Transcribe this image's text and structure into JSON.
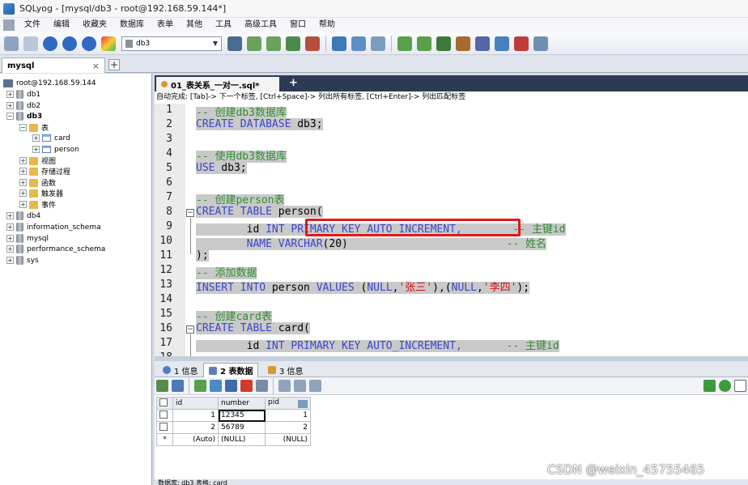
{
  "window": {
    "title": "SQLyog - [mysql/db3 - root@192.168.59.144*]"
  },
  "menu": [
    "文件",
    "编辑",
    "收藏夹",
    "数据库",
    "表单",
    "其他",
    "工具",
    "高级工具",
    "窗口",
    "帮助"
  ],
  "toolbar": {
    "selected_db": "db3"
  },
  "connection_tab": {
    "label": "mysql",
    "close": "×",
    "add": "+"
  },
  "tree": {
    "server": "root@192.168.59.144",
    "db1": "db1",
    "db2": "db2",
    "db3": "db3",
    "tables_folder": "表",
    "table_card": "card",
    "table_person": "person",
    "views": "视图",
    "procedures": "存储过程",
    "functions": "函数",
    "triggers": "触发器",
    "events": "事件",
    "db4": "db4",
    "information_schema": "information_schema",
    "mysql": "mysql",
    "performance_schema": "performance_schema",
    "sys": "sys"
  },
  "editor": {
    "tab_label": "01_表关系_一对一.sql*",
    "add_tab": "+",
    "autocomplete_hint": "自动完成: [Tab]-> 下一个标签, [Ctrl+Space]-> 列出所有标签, [Ctrl+Enter]-> 列出匹配标签",
    "line_numbers": [
      "1",
      "2",
      "3",
      "4",
      "5",
      "6",
      "7",
      "8",
      "9",
      "10",
      "11",
      "12",
      "13",
      "14",
      "15",
      "16",
      "17",
      "18"
    ],
    "lines": {
      "l1": "-- 创建db3数据库",
      "l2_kw": "CREATE DATABASE",
      "l2_rest": " db3;",
      "l4": "-- 使用db3数据库",
      "l5_kw": "USE",
      "l5_rest": " db3;",
      "l7": "-- 创建person表",
      "l8_kw": "CREATE TABLE",
      "l8_rest": " person(",
      "l9_a": "        id ",
      "l9_kw": "INT PRIMARY KEY AUTO_INCREMENT,",
      "l9_pad": "        ",
      "l9_c": "-- 主键id",
      "l10_a": "        ",
      "l10_kw": "NAME VARCHAR",
      "l10_b": "(20)",
      "l10_pad": "                         ",
      "l10_c": "-- 姓名",
      "l11": ");",
      "l12": "-- 添加数据",
      "l13_kw1": "INSERT INTO",
      "l13_a": " person ",
      "l13_kw2": "VALUES",
      "l13_b": " (",
      "l13_n1": "NULL",
      "l13_s1": "'张三'",
      "l13_c1": "),(",
      "l13_n2": "NULL",
      "l13_s2": "'李四'",
      "l13_end": ");",
      "l15": "-- 创建card表",
      "l16_kw": "CREATE TABLE",
      "l16_rest": " card(",
      "l17_a": "        id ",
      "l17_kw": "INT PRIMARY KEY AUTO_INCREMENT,",
      "l17_pad": "       ",
      "l17_c": "-- 主键id"
    }
  },
  "results": {
    "tabs": [
      "1 信息",
      "2 表数据",
      "3 信息"
    ],
    "columns": [
      "id",
      "number",
      "pid"
    ],
    "rows": [
      {
        "id": "1",
        "number": "12345",
        "pid": "1"
      },
      {
        "id": "2",
        "number": "56789",
        "pid": "2"
      },
      {
        "id": "(Auto)",
        "number": "(NULL)",
        "pid": "(NULL)"
      }
    ],
    "new_row_marker": "*"
  },
  "status": {
    "text": "数据库: db3 表格: card"
  },
  "watermark": "CSDN @weixin_45755465"
}
